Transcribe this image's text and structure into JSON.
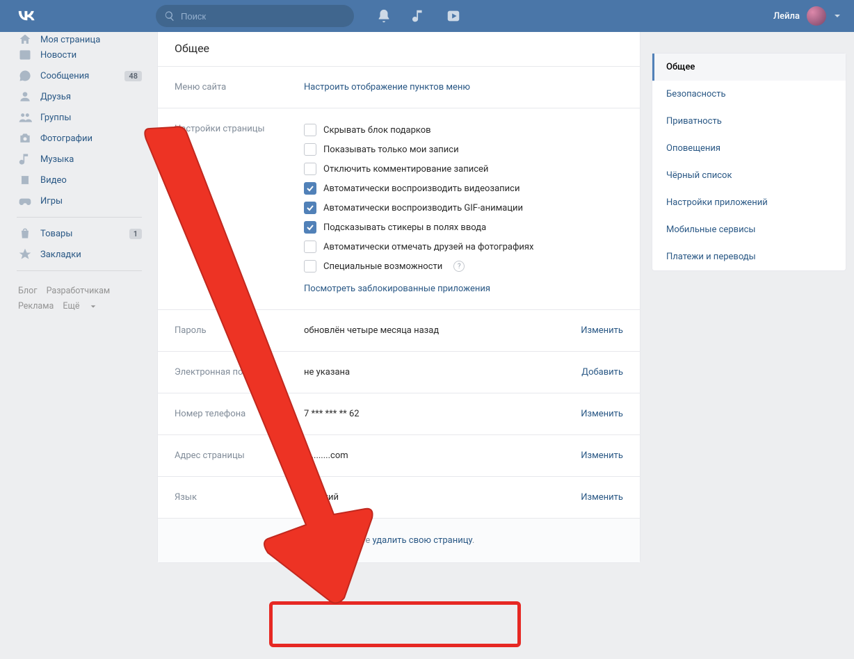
{
  "header": {
    "search_placeholder": "Поиск",
    "username": "Лейла"
  },
  "left_nav": {
    "my_page": "Моя страница",
    "news": "Новости",
    "messages": "Сообщения",
    "messages_badge": "48",
    "friends": "Друзья",
    "groups": "Группы",
    "photos": "Фотографии",
    "music": "Музыка",
    "video": "Видео",
    "games": "Игры",
    "market": "Товары",
    "market_badge": "1",
    "bookmarks": "Закладки"
  },
  "footer_links": {
    "blog": "Блог",
    "devs": "Разработчикам",
    "ads": "Реклама",
    "more": "Ещё"
  },
  "main": {
    "title": "Общее",
    "menu_label": "Меню сайта",
    "menu_link": "Настроить отображение пунктов меню",
    "page_settings_label": "Настройки страницы",
    "checks": [
      {
        "label": "Скрывать блок подарков",
        "on": false
      },
      {
        "label": "Показывать только мои записи",
        "on": false
      },
      {
        "label": "Отключить комментирование записей",
        "on": false
      },
      {
        "label": "Автоматически воспроизводить видеозаписи",
        "on": true
      },
      {
        "label": "Автоматически воспроизводить GIF-анимации",
        "on": true
      },
      {
        "label": "Подсказывать стикеры в полях ввода",
        "on": true
      },
      {
        "label": "Автоматически отмечать друзей на фотографиях",
        "on": false
      },
      {
        "label": "Специальные возможности",
        "on": false,
        "help": true
      }
    ],
    "blocked_apps_link": "Посмотреть заблокированные приложения",
    "password_label": "Пароль",
    "password_value": "обновлён четыре месяца назад",
    "password_action": "Изменить",
    "email_label": "Электронная почта",
    "email_value": "не указана",
    "email_action": "Добавить",
    "phone_label": "Номер телефона",
    "phone_value": "7 *** *** ** 62",
    "phone_action": "Изменить",
    "url_label": "Адрес страницы",
    "url_value": "h.........com",
    "url_action": "Изменить",
    "lang_label": "Язык",
    "lang_value": "Русский",
    "lang_action": "Изменить",
    "delete_prefix": "Вы можете ",
    "delete_link": "удалить свою страницу",
    "delete_suffix": "."
  },
  "right_nav": [
    "Общее",
    "Безопасность",
    "Приватность",
    "Оповещения",
    "Чёрный список",
    "Настройки приложений",
    "Мобильные сервисы",
    "Платежи и переводы"
  ]
}
